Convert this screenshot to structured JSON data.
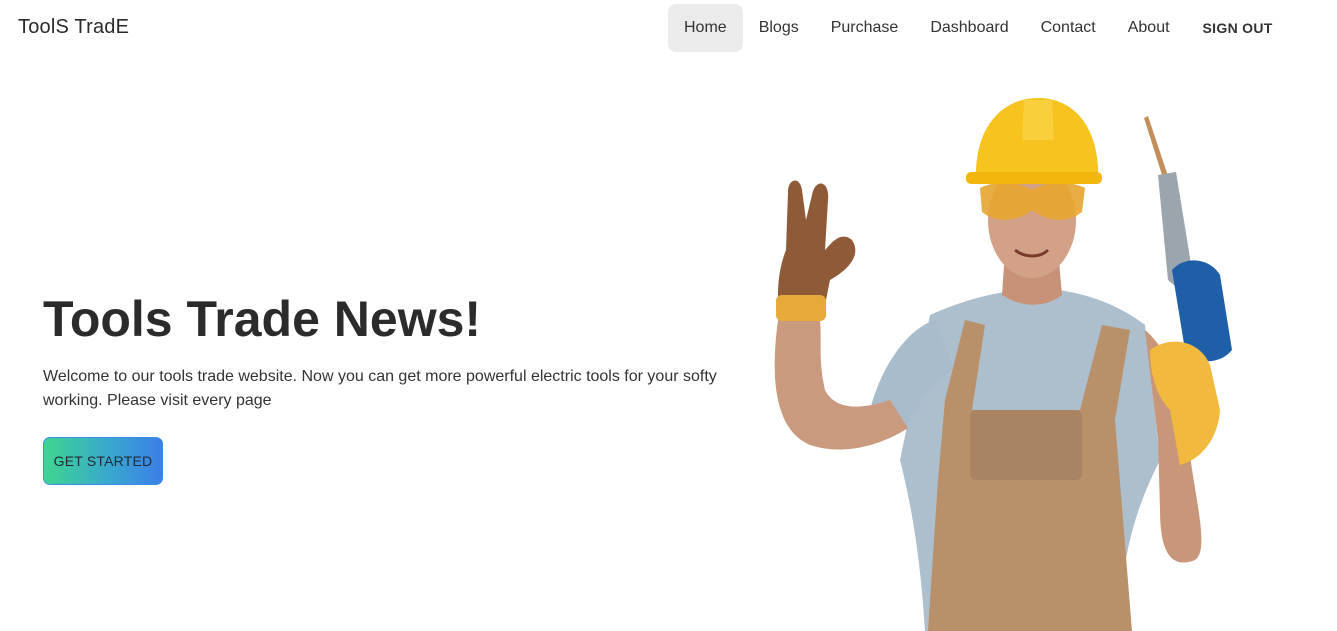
{
  "brand": "ToolS TradE",
  "nav": {
    "items": [
      "Home",
      "Blogs",
      "Purchase",
      "Dashboard",
      "Contact",
      "About"
    ],
    "active": "Home",
    "signout": "SIGN OUT"
  },
  "hero": {
    "title": "Tools Trade News!",
    "text": "Welcome to our tools trade website. Now you can get more powerful electric tools for your softy working. Please visit every page",
    "button": "GET STARTED"
  },
  "colors": {
    "cta_gradient_start": "#3fd58f",
    "cta_gradient_end": "#3b7fe9",
    "active_nav_bg": "#ebebeb",
    "helmet": "#f7c31e",
    "overalls": "#b8916b",
    "shirt": "#aebfce",
    "drill": "#1f5fa8"
  }
}
